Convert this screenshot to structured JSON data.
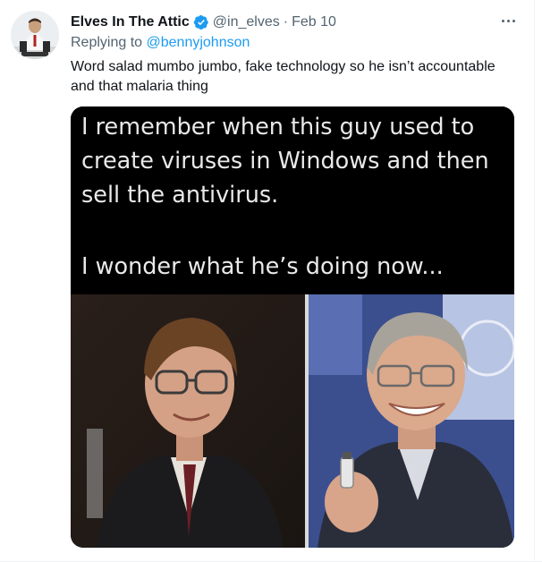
{
  "author": {
    "name": "Elves In The Attic",
    "handle": "@in_elves",
    "separator": "·",
    "date": "Feb 10"
  },
  "reply": {
    "prefix": "Replying to",
    "target": "@bennyjohnson"
  },
  "tweet_text": "Word salad mumbo jumbo, fake technology so he isn’t accountable and that malaria thing",
  "meme": {
    "line1": "I remember when this guy used to",
    "line2": "create viruses in Windows and then",
    "line3": "sell the antivirus.",
    "line4": "I wonder what he’s doing now..."
  },
  "icons": {
    "verified": "verified-badge-icon",
    "more": "more-options-icon"
  },
  "colors": {
    "text_primary": "#0f1419",
    "text_secondary": "#536471",
    "link": "#1d9bf0",
    "verified": "#1d9bf0"
  }
}
